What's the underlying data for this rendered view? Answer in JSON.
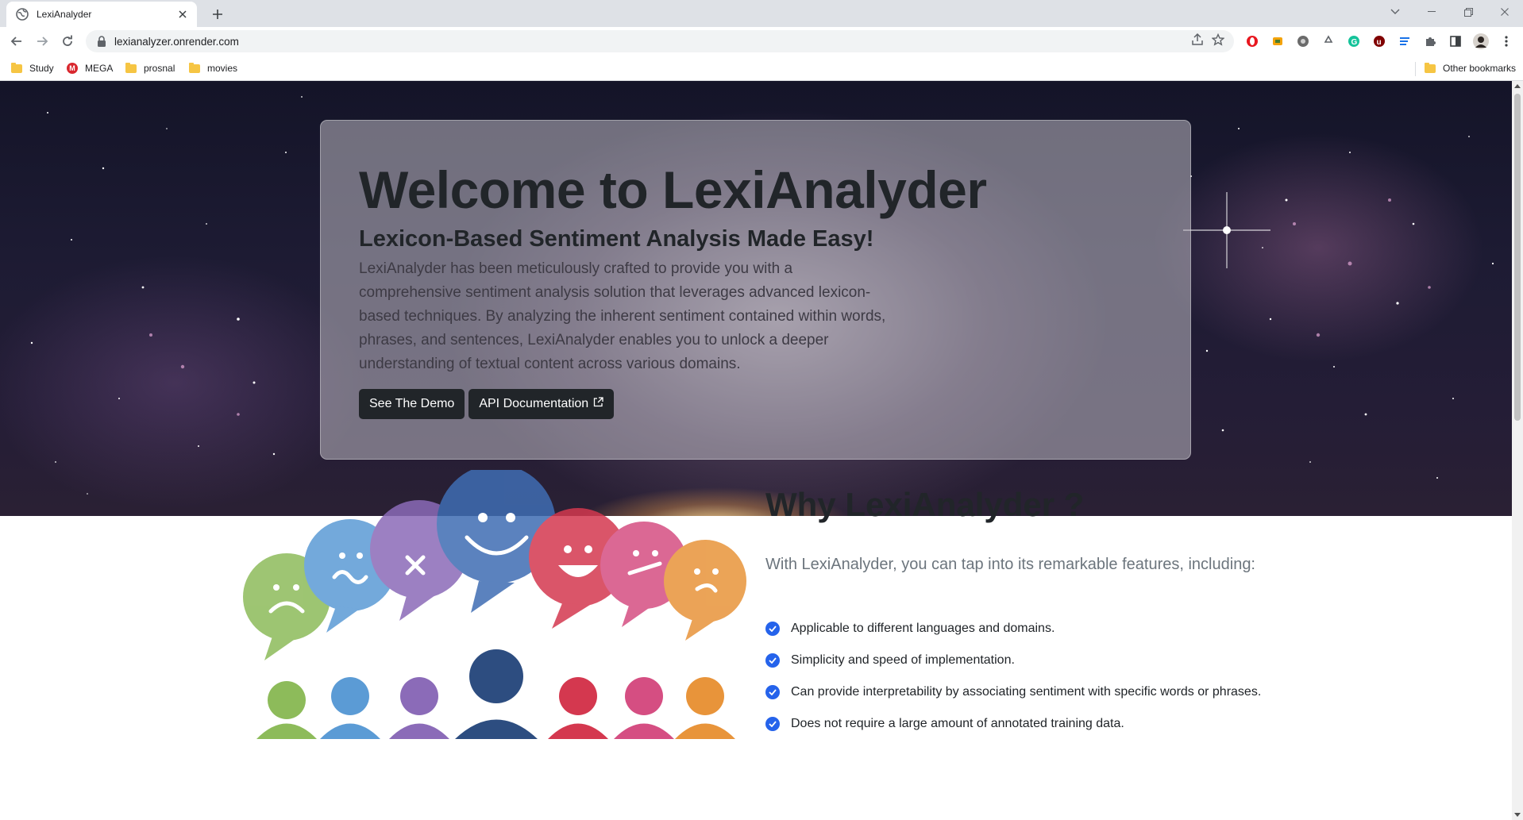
{
  "browser": {
    "tab": {
      "title": "LexiAnalyder"
    },
    "url": "lexianalyzer.onrender.com",
    "bookmarks": [
      {
        "label": "Study",
        "icon": "folder-icon"
      },
      {
        "label": "MEGA",
        "icon": "mega-icon"
      },
      {
        "label": "prosnal",
        "icon": "folder-icon"
      },
      {
        "label": "movies",
        "icon": "folder-icon"
      }
    ],
    "other_bookmarks": "Other bookmarks",
    "extensions": [
      "opera-icon",
      "extension-icon",
      "extension-icon",
      "recycle-icon",
      "grammarly-icon",
      "ublock-icon",
      "reading-list-icon",
      "puzzle-icon",
      "sidepanel-icon",
      "profile-avatar",
      "kebab-menu-icon"
    ]
  },
  "hero": {
    "title": "Welcome to LexiAnalyder",
    "subtitle": "Lexicon-Based Sentiment Analysis Made Easy!",
    "description": "LexiAnalyder has been meticulously crafted to provide you with a comprehensive sentiment analysis solution that leverages advanced lexicon-based techniques. By analyzing the inherent sentiment contained within words, phrases, and sentences, LexiAnalyder enables you to unlock a deeper understanding of textual content across various domains.",
    "buttons": {
      "demo": "See The Demo",
      "api": "API Documentation"
    }
  },
  "why": {
    "title": "Why LexiAnalyder ?",
    "lead": "With LexiAnalyder, you can tap into its remarkable features, including:",
    "features": [
      "Applicable to different languages and domains.",
      "Simplicity and speed of implementation.",
      "Can provide interpretability by associating sentiment with specific words or phrases.",
      "Does not require a large amount of annotated training data."
    ]
  },
  "colors": {
    "accent": "#2563eb",
    "button_dark": "#212529"
  }
}
